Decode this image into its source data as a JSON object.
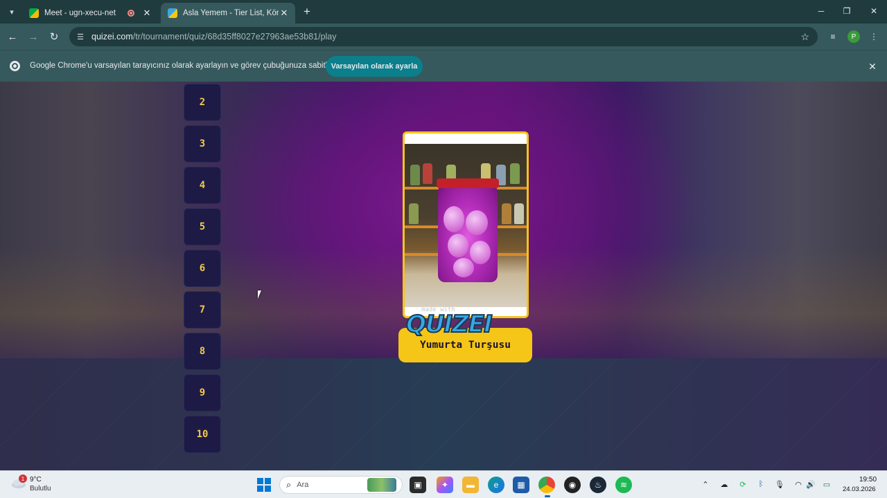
{
  "browser": {
    "tabs": [
      {
        "title": "Meet - ugn-xecu-net",
        "active": false,
        "recording": true
      },
      {
        "title": "Asla Yemem - Tier List, Kör Sıral",
        "active": true
      }
    ],
    "url_host": "quizei.com",
    "url_path": "/tr/tournament/quiz/68d35ff8027e27963ae53b81/play",
    "profile_initial": "P"
  },
  "infobar": {
    "message": "Google Chrome'u varsayılan tarayıcınız olarak ayarlayın ve görev çubuğunuza sabitleyin",
    "button_label": "Varsayılan olarak ayarla"
  },
  "quiz": {
    "ranks": [
      "2",
      "3",
      "4",
      "5",
      "6",
      "7",
      "8",
      "9",
      "10"
    ],
    "card_watermark": "made with",
    "card_logo": "QUIZEI",
    "card_name": "Yumurta Turşusu"
  },
  "taskbar": {
    "weather_temp": "9°C",
    "weather_desc": "Bulutlu",
    "weather_badge": "1",
    "search_placeholder": "Ara",
    "time": "19:50",
    "date": "24.03.2026"
  },
  "colors": {
    "accent": "#f5c518",
    "rank_bg": "#1d1b45",
    "infobar_button": "#0b7f8c",
    "chrome_toolbar": "#35595c"
  }
}
